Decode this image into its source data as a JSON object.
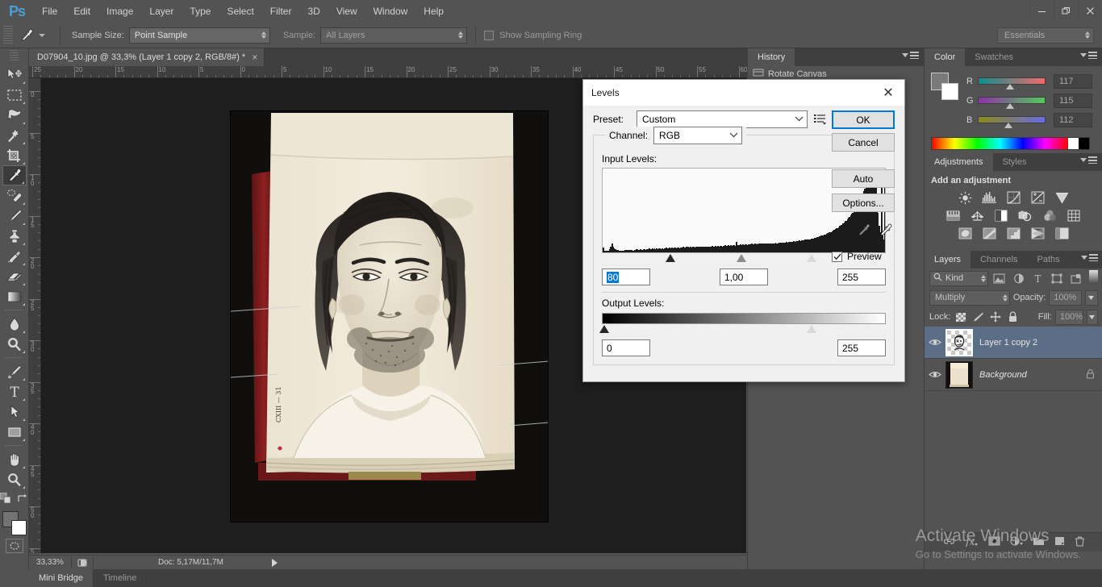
{
  "app": {
    "logo": "Ps",
    "menu": [
      "File",
      "Edit",
      "Image",
      "Layer",
      "Type",
      "Select",
      "Filter",
      "3D",
      "View",
      "Window",
      "Help"
    ],
    "window_controls": [
      "minimize-icon",
      "restore-icon",
      "close-icon"
    ]
  },
  "options_bar": {
    "tool_icon": "eyedropper-icon",
    "sample_size_label": "Sample Size:",
    "sample_size_value": "Point Sample",
    "sample_label": "Sample:",
    "sample_value": "All Layers",
    "show_sampling_ring_label": "Show Sampling Ring",
    "show_sampling_ring_checked": false,
    "workspace": "Essentials"
  },
  "document": {
    "tab_title": "D07904_10.jpg @ 33,3% (Layer 1 copy 2, RGB/8#) *",
    "close_glyph": "×",
    "ruler_h_labels": [
      "25",
      "20",
      "15",
      "10",
      "5",
      "0",
      "5",
      "10",
      "15",
      "20",
      "25",
      "30",
      "35",
      "40",
      "45",
      "50",
      "55",
      "60"
    ],
    "ruler_v_labels": [
      "0",
      "5",
      "10",
      "15",
      "20",
      "25",
      "30",
      "35",
      "40",
      "45",
      "50",
      "55"
    ]
  },
  "status_bar": {
    "zoom": "33,33%",
    "doc_label": "Doc: 5,17M/11,7M",
    "proof_icon": "proof-colors-icon",
    "expand_icon": "play-arrow-icon"
  },
  "bottom_dock": {
    "tabs": [
      {
        "label": "Mini Bridge",
        "active": true
      },
      {
        "label": "Timeline",
        "active": false
      }
    ]
  },
  "toolbox": {
    "tools": [
      {
        "name": "move-tool",
        "icon": "move-icon",
        "active": false
      },
      {
        "name": "rectangular-marquee-tool",
        "icon": "marquee-icon",
        "active": false
      },
      {
        "name": "lasso-tool",
        "icon": "lasso-icon",
        "active": false
      },
      {
        "name": "magic-wand-tool",
        "icon": "magic-wand-icon",
        "active": false
      },
      {
        "name": "crop-tool",
        "icon": "crop-icon",
        "active": false
      },
      {
        "name": "eyedropper-tool",
        "icon": "eyedropper-icon",
        "active": true
      },
      {
        "name": "spot-healing-brush-tool",
        "icon": "healing-brush-icon",
        "active": false
      },
      {
        "name": "brush-tool",
        "icon": "brush-icon",
        "active": false
      },
      {
        "name": "clone-stamp-tool",
        "icon": "clone-stamp-icon",
        "active": false
      },
      {
        "name": "history-brush-tool",
        "icon": "history-brush-icon",
        "active": false
      },
      {
        "name": "eraser-tool",
        "icon": "eraser-icon",
        "active": false
      },
      {
        "name": "gradient-tool",
        "icon": "gradient-icon",
        "active": false
      },
      {
        "name": "blur-tool",
        "icon": "blur-drop-icon",
        "active": false
      },
      {
        "name": "dodge-tool",
        "icon": "dodge-icon",
        "active": false
      },
      {
        "name": "pen-tool",
        "icon": "pen-icon",
        "active": false
      },
      {
        "name": "type-tool",
        "icon": "type-t-icon",
        "active": false
      },
      {
        "name": "path-selection-tool",
        "icon": "path-arrow-icon",
        "active": false
      },
      {
        "name": "rectangle-tool",
        "icon": "rectangle-icon",
        "active": false
      },
      {
        "name": "hand-tool",
        "icon": "hand-icon",
        "active": false
      },
      {
        "name": "zoom-tool",
        "icon": "zoom-magnifier-icon",
        "active": false
      }
    ],
    "foreground_color": "#7c7a78",
    "background_color": "#ffffff"
  },
  "history_panel": {
    "tabs": [
      {
        "label": "History",
        "active": true
      }
    ],
    "items": [
      {
        "label": "Rotate Canvas",
        "icon": "rotate-canvas-icon"
      }
    ]
  },
  "color_panel": {
    "tabs": [
      {
        "label": "Color",
        "active": true
      },
      {
        "label": "Swatches",
        "active": false
      }
    ],
    "channels": [
      {
        "name": "R",
        "value": "117",
        "pos": 46
      },
      {
        "name": "G",
        "value": "115",
        "pos": 45
      },
      {
        "name": "B",
        "value": "112",
        "pos": 44
      }
    ],
    "foreground": "#757371",
    "background": "#ffffff"
  },
  "adjustments_panel": {
    "tabs": [
      {
        "label": "Adjustments",
        "active": true
      },
      {
        "label": "Styles",
        "active": false
      }
    ],
    "title": "Add an adjustment",
    "icons": [
      "brightness-contrast-icon",
      "levels-icon",
      "curves-icon",
      "exposure-icon",
      "vibrance-icon",
      "hue-saturation-icon",
      "color-balance-icon",
      "black-white-icon",
      "photo-filter-icon",
      "channel-mixer-icon",
      "color-lookup-icon",
      "invert-icon",
      "posterize-icon",
      "threshold-icon",
      "gradient-map-icon",
      "selective-color-icon"
    ]
  },
  "layers_panel": {
    "tabs": [
      {
        "label": "Layers",
        "active": true
      },
      {
        "label": "Channels",
        "active": false
      },
      {
        "label": "Paths",
        "active": false
      }
    ],
    "filter_label": "Kind",
    "filter_icons": [
      "pixel-filter-icon",
      "adjustment-filter-icon",
      "type-filter-icon",
      "shape-filter-icon",
      "smartobject-filter-icon"
    ],
    "blend_mode": "Multiply",
    "opacity_label": "Opacity:",
    "opacity_value": "100%",
    "lock_label": "Lock:",
    "lock_icons": [
      "lock-transparency-icon",
      "lock-image-icon",
      "lock-position-icon",
      "lock-all-icon"
    ],
    "fill_label": "Fill:",
    "fill_value": "100%",
    "layers": [
      {
        "name": "Layer 1 copy 2",
        "visible": true,
        "selected": true,
        "locked": false,
        "italic": false
      },
      {
        "name": "Background",
        "visible": true,
        "selected": false,
        "locked": true,
        "italic": true
      }
    ],
    "bottom_icons": [
      "link-layers-icon",
      "fx-icon",
      "layer-mask-icon",
      "new-adjustment-layer-icon",
      "new-group-icon",
      "new-layer-icon",
      "delete-layer-icon"
    ]
  },
  "levels_dialog": {
    "title": "Levels",
    "close_glyph": "✕",
    "preset_label": "Preset:",
    "preset_value": "Custom",
    "preset_menu_icon": "preset-options-icon",
    "channel_label": "Channel:",
    "channel_value": "RGB",
    "input_levels_label": "Input Levels:",
    "input_shadow": "80",
    "input_midtone": "1,00",
    "input_highlight": "255",
    "output_levels_label": "Output Levels:",
    "output_black": "0",
    "output_white": "255",
    "buttons": {
      "ok": "OK",
      "cancel": "Cancel",
      "auto": "Auto",
      "options": "Options..."
    },
    "eyedroppers": [
      "set-black-point-icon",
      "set-gray-point-icon",
      "set-white-point-icon"
    ],
    "preview_label": "Preview",
    "preview_checked": true,
    "accent_color": "#0078d7",
    "histogram": [
      7,
      3,
      2,
      2,
      2,
      3,
      5,
      9,
      14,
      9,
      6,
      5,
      4,
      4,
      3,
      3,
      3,
      3,
      3,
      3,
      4,
      4,
      4,
      4,
      4,
      4,
      4,
      3,
      3,
      4,
      5,
      5,
      4,
      4,
      5,
      4,
      4,
      5,
      5,
      4,
      5,
      5,
      6,
      5,
      5,
      6,
      5,
      6,
      5,
      6,
      5,
      6,
      6,
      5,
      6,
      5,
      6,
      6,
      7,
      6,
      6,
      7,
      6,
      7,
      6,
      7,
      7,
      6,
      7,
      7,
      6,
      7,
      7,
      8,
      7,
      7,
      8,
      7,
      8,
      7,
      8,
      7,
      8,
      8,
      7,
      8,
      8,
      9,
      8,
      8,
      9,
      8,
      9,
      8,
      9,
      9,
      8,
      9,
      9,
      9,
      10,
      9,
      9,
      10,
      9,
      10,
      9,
      10,
      10,
      9,
      10,
      10,
      11,
      10,
      10,
      11,
      10,
      11,
      10,
      11,
      11,
      10,
      16,
      11,
      11,
      11,
      12,
      11,
      12,
      11,
      12,
      12,
      11,
      12,
      12,
      12,
      13,
      12,
      12,
      13,
      12,
      13,
      12,
      13,
      13,
      12,
      13,
      13,
      14,
      13,
      13,
      14,
      13,
      14,
      14,
      13,
      14,
      14,
      15,
      14,
      14,
      15,
      14,
      15,
      15,
      14,
      15,
      15,
      16,
      15,
      16,
      15,
      16,
      16,
      16,
      17,
      16,
      17,
      17,
      17,
      18,
      17,
      18,
      18,
      18,
      19,
      19,
      19,
      20,
      20,
      20,
      21,
      21,
      21,
      22,
      22,
      23,
      23,
      24,
      24,
      25,
      25,
      26,
      27,
      27,
      28,
      29,
      30,
      30,
      31,
      32,
      33,
      34,
      35,
      36,
      37,
      38,
      40,
      41,
      42,
      44,
      45,
      47,
      48,
      50,
      52,
      54,
      56,
      58,
      60,
      63,
      65,
      68,
      71,
      74,
      77,
      81,
      84,
      88,
      92,
      96,
      100,
      93,
      104,
      108,
      112,
      116,
      98,
      120,
      124,
      100,
      80,
      60,
      40,
      30,
      102,
      25,
      20,
      100
    ]
  },
  "watermark": {
    "line1": "Activate Windows",
    "line2": "Go to Settings to activate Windows."
  }
}
